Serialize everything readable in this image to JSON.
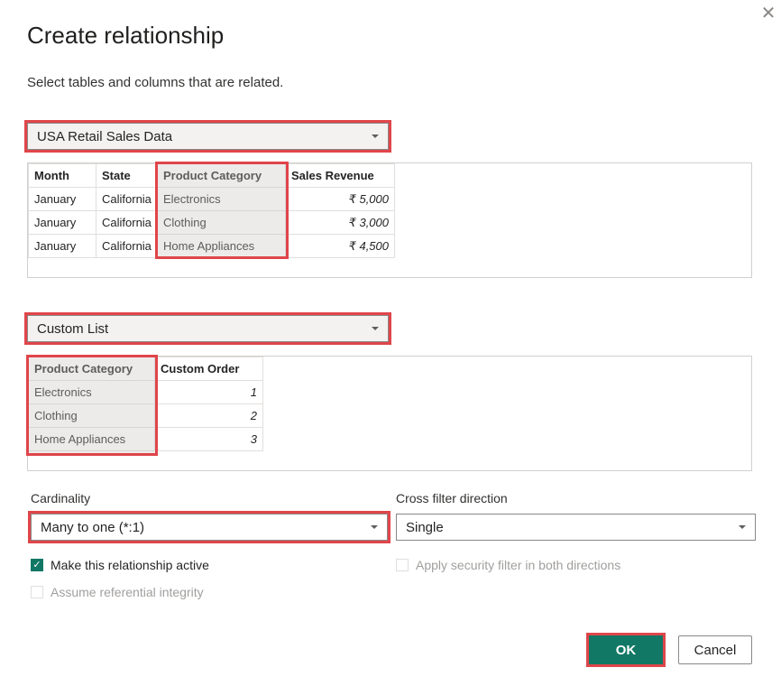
{
  "dialog": {
    "title": "Create relationship",
    "subtitle": "Select tables and columns that are related.",
    "close_icon": "close-icon",
    "close_glyph": "✕"
  },
  "table1": {
    "selected": "USA Retail Sales Data",
    "columns": [
      "Month",
      "State",
      "Product Category",
      "Sales Revenue"
    ],
    "rows": [
      [
        "January",
        "California",
        "Electronics",
        "₹ 5,000"
      ],
      [
        "January",
        "California",
        "Clothing",
        "₹ 3,000"
      ],
      [
        "January",
        "California",
        "Home Appliances",
        "₹ 4,500"
      ]
    ],
    "highlighted_column": "Product Category"
  },
  "table2": {
    "selected": "Custom List",
    "columns": [
      "Product Category",
      "Custom Order"
    ],
    "rows": [
      [
        "Electronics",
        "1"
      ],
      [
        "Clothing",
        "2"
      ],
      [
        "Home Appliances",
        "3"
      ]
    ],
    "highlighted_column": "Product Category"
  },
  "cardinality": {
    "label": "Cardinality",
    "selected": "Many to one (*:1)"
  },
  "cross_filter": {
    "label": "Cross filter direction",
    "selected": "Single"
  },
  "options": {
    "make_active": {
      "label": "Make this relationship active",
      "checked": true,
      "glyph": "✓"
    },
    "referential_integrity": {
      "label": "Assume referential integrity",
      "checked": false,
      "enabled": false
    },
    "security_filter": {
      "label": "Apply security filter in both directions",
      "checked": false,
      "enabled": false
    }
  },
  "buttons": {
    "ok": "OK",
    "cancel": "Cancel"
  },
  "colors": {
    "accent": "#117865",
    "highlight": "#e0454a"
  }
}
